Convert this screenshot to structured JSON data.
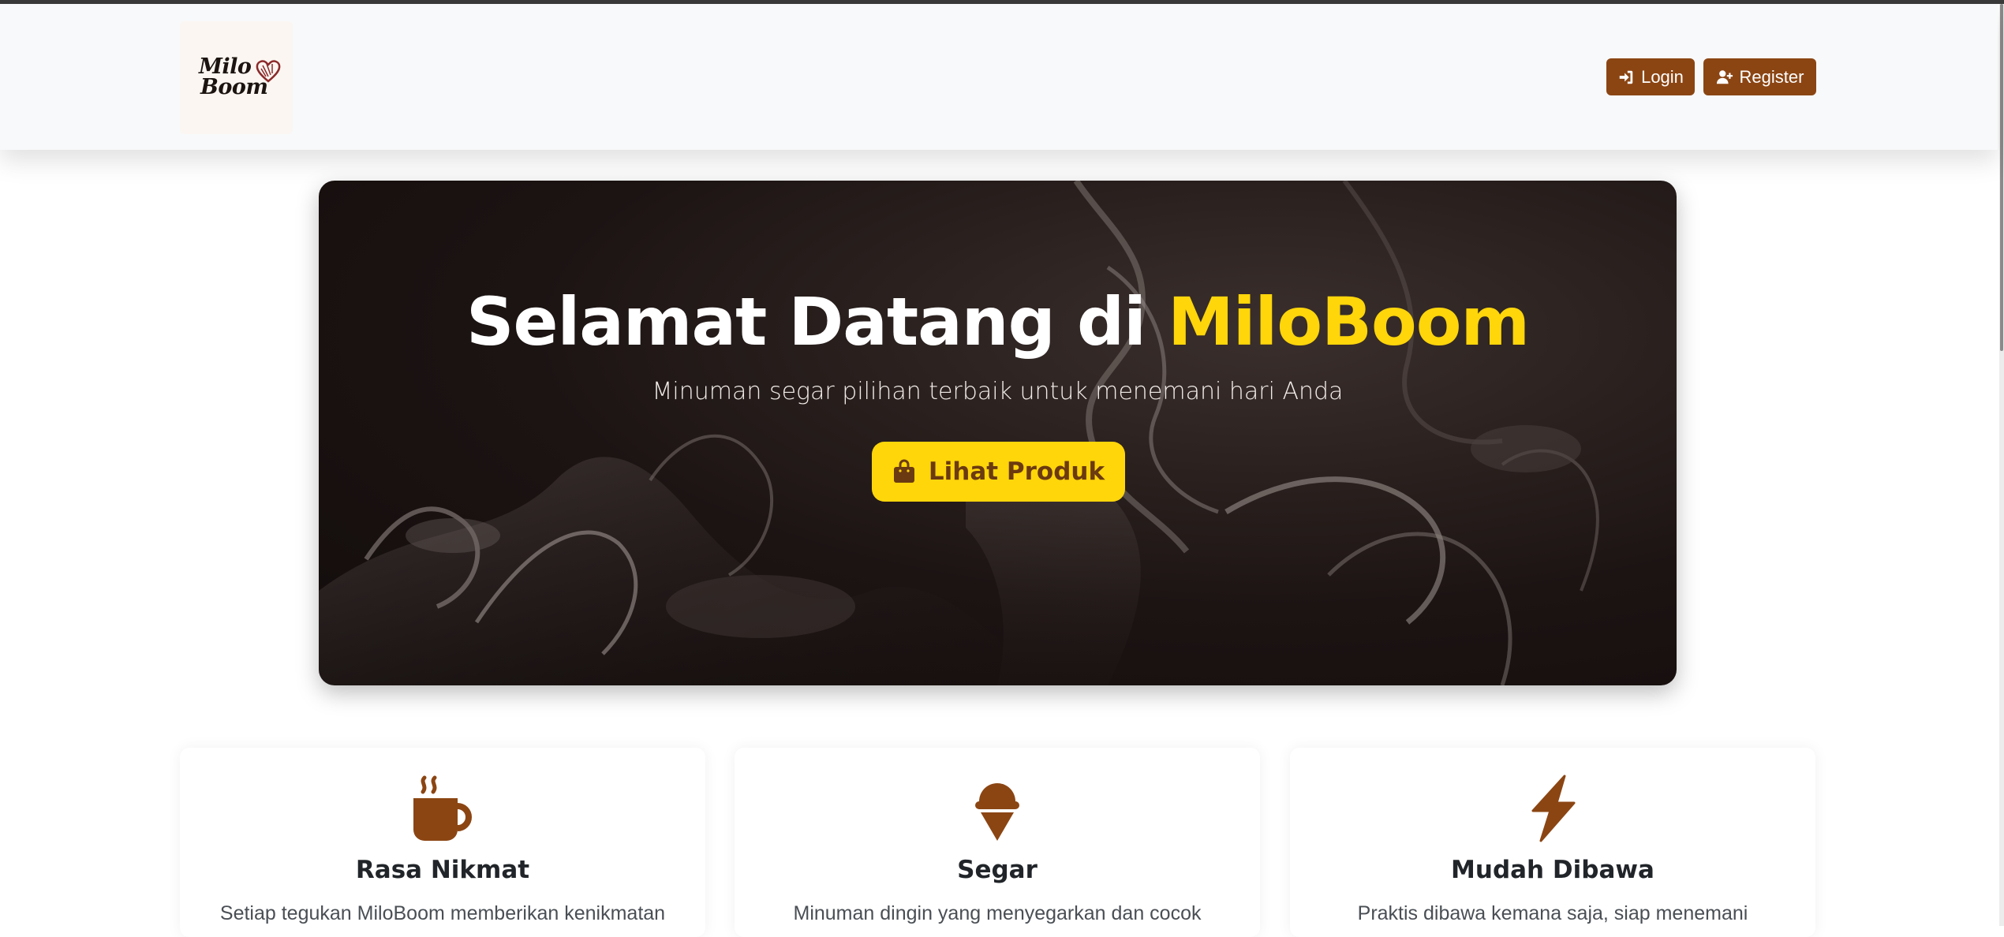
{
  "navbar": {
    "logo_text_line1": "Milo",
    "logo_text_line2": "Boom",
    "login_label": "Login",
    "register_label": "Register"
  },
  "hero": {
    "title_prefix": "Selamat Datang di ",
    "title_brand": "MiloBoom",
    "subtitle": "Minuman segar pilihan terbaik untuk menemani hari Anda",
    "cta_label": "Lihat Produk"
  },
  "features": [
    {
      "icon": "coffee-cup-icon",
      "title": "Rasa Nikmat",
      "text": "Setiap tegukan MiloBoom memberikan kenikmatan"
    },
    {
      "icon": "ice-cream-icon",
      "title": "Segar",
      "text": "Minuman dingin yang menyegarkan dan cocok"
    },
    {
      "icon": "lightning-bolt-icon",
      "title": "Mudah Dibawa",
      "text": "Praktis dibawa kemana saja, siap menemani"
    }
  ],
  "colors": {
    "brand_brown": "#8b4513",
    "accent_yellow": "#ffd60a",
    "navbar_bg": "#f8f9fa"
  }
}
